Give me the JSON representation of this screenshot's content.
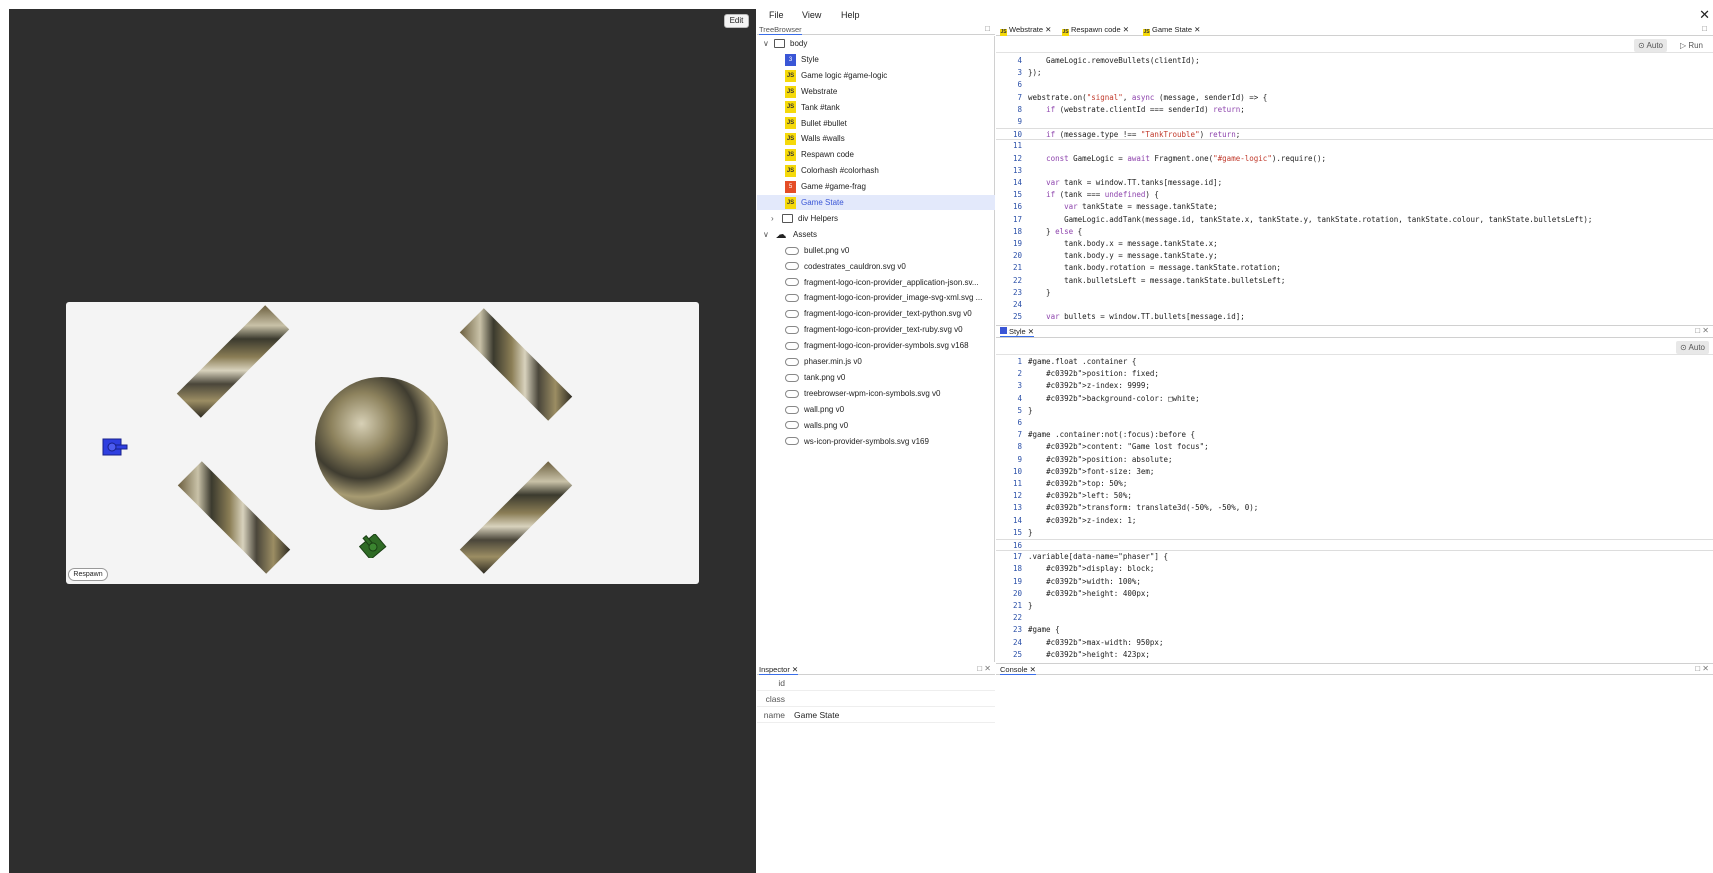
{
  "game": {
    "edit_label": "Edit",
    "respawn_label": "Respawn",
    "tank_colors": {
      "blue": "#2f3fe0",
      "green": "#2f6b25"
    }
  },
  "menubar": {
    "file": "File",
    "view": "View",
    "help": "Help",
    "close": "✕"
  },
  "tree": {
    "header": "TreeBrowser",
    "items": [
      {
        "label": "body",
        "kind": "folder"
      },
      {
        "label": "Style",
        "kind": "css"
      },
      {
        "label": "Game logic #game-logic",
        "kind": "js"
      },
      {
        "label": "Webstrate",
        "kind": "js"
      },
      {
        "label": "Tank #tank",
        "kind": "js"
      },
      {
        "label": "Bullet #bullet",
        "kind": "js"
      },
      {
        "label": "Walls #walls",
        "kind": "js"
      },
      {
        "label": "Respawn code",
        "kind": "js"
      },
      {
        "label": "Colorhash #colorhash",
        "kind": "js"
      },
      {
        "label": "Game #game-frag",
        "kind": "html"
      },
      {
        "label": "Game State",
        "kind": "js"
      },
      {
        "label": "div Helpers",
        "kind": "folder"
      },
      {
        "label": "Assets",
        "kind": "cloud"
      },
      {
        "label": "bullet.png v0",
        "kind": "asset"
      },
      {
        "label": "codestrates_cauldron.svg v0",
        "kind": "asset"
      },
      {
        "label": "fragment-logo-icon-provider_application-json.sv...",
        "kind": "asset"
      },
      {
        "label": "fragment-logo-icon-provider_image-svg-xml.svg ...",
        "kind": "asset"
      },
      {
        "label": "fragment-logo-icon-provider_text-python.svg v0",
        "kind": "asset"
      },
      {
        "label": "fragment-logo-icon-provider_text-ruby.svg v0",
        "kind": "asset"
      },
      {
        "label": "fragment-logo-icon-provider-symbols.svg v168",
        "kind": "asset"
      },
      {
        "label": "phaser.min.js v0",
        "kind": "asset"
      },
      {
        "label": "tank.png v0",
        "kind": "asset"
      },
      {
        "label": "treebrowser-wpm-icon-symbols.svg v0",
        "kind": "asset"
      },
      {
        "label": "wall.png v0",
        "kind": "asset"
      },
      {
        "label": "walls.png v0",
        "kind": "asset"
      },
      {
        "label": "ws-icon-provider-symbols.svg v169",
        "kind": "asset"
      }
    ]
  },
  "inspector": {
    "header": "Inspector ✕",
    "rows": [
      {
        "key": "id",
        "value": ""
      },
      {
        "key": "class",
        "value": ""
      },
      {
        "key": "name",
        "value": "Game State"
      }
    ]
  },
  "editor": {
    "tabs": [
      "Webstrate ✕",
      "Respawn code ✕",
      "Game State ✕"
    ],
    "auto_label": "Auto",
    "run_label": "Run",
    "lines": [
      {
        "n": "4",
        "text": "    GameLogic.removeBullets(clientId);"
      },
      {
        "n": "3",
        "text": "});"
      },
      {
        "n": "6",
        "text": ""
      },
      {
        "n": "7",
        "text": "webstrate.on(\"signal\", async (message, senderId) => {"
      },
      {
        "n": "8",
        "text": "    if (webstrate.clientId === senderId) return;"
      },
      {
        "n": "9",
        "text": ""
      },
      {
        "n": "10",
        "text": "    if (message.type !== \"TankTrouble\") return;"
      },
      {
        "n": "11",
        "text": ""
      },
      {
        "n": "12",
        "text": "    const GameLogic = await Fragment.one(\"#game-logic\").require();"
      },
      {
        "n": "13",
        "text": ""
      },
      {
        "n": "14",
        "text": "    var tank = window.TT.tanks[message.id];"
      },
      {
        "n": "15",
        "text": "    if (tank === undefined) {"
      },
      {
        "n": "16",
        "text": "        var tankState = message.tankState;"
      },
      {
        "n": "17",
        "text": "        GameLogic.addTank(message.id, tankState.x, tankState.y, tankState.rotation, tankState.colour, tankState.bulletsLeft);"
      },
      {
        "n": "18",
        "text": "    } else {"
      },
      {
        "n": "19",
        "text": "        tank.body.x = message.tankState.x;"
      },
      {
        "n": "20",
        "text": "        tank.body.y = message.tankState.y;"
      },
      {
        "n": "21",
        "text": "        tank.body.rotation = message.tankState.rotation;"
      },
      {
        "n": "22",
        "text": "        tank.bulletsLeft = message.tankState.bulletsLeft;"
      },
      {
        "n": "23",
        "text": "    }"
      },
      {
        "n": "24",
        "text": ""
      },
      {
        "n": "25",
        "text": "    var bullets = window.TT.bullets[message.id];"
      }
    ]
  },
  "style_editor": {
    "tab": "Style ✕",
    "auto_label": "Auto",
    "lines": [
      {
        "n": "1",
        "text": "#game.float .container {"
      },
      {
        "n": "2",
        "text": "    position: fixed;"
      },
      {
        "n": "3",
        "text": "    z-index: 9999;"
      },
      {
        "n": "4",
        "text": "    background-color: □white;"
      },
      {
        "n": "5",
        "text": "}"
      },
      {
        "n": "6",
        "text": ""
      },
      {
        "n": "7",
        "text": "#game .container:not(:focus):before {"
      },
      {
        "n": "8",
        "text": "    content: \"Game lost focus\";"
      },
      {
        "n": "9",
        "text": "    position: absolute;"
      },
      {
        "n": "10",
        "text": "    font-size: 3em;"
      },
      {
        "n": "11",
        "text": "    top: 50%;"
      },
      {
        "n": "12",
        "text": "    left: 50%;"
      },
      {
        "n": "13",
        "text": "    transform: translate3d(-50%, -50%, 0);"
      },
      {
        "n": "14",
        "text": "    z-index: 1;"
      },
      {
        "n": "15",
        "text": "}"
      },
      {
        "n": "16",
        "text": ""
      },
      {
        "n": "17",
        "text": ".variable[data-name=\"phaser\"] {"
      },
      {
        "n": "18",
        "text": "    display: block;"
      },
      {
        "n": "19",
        "text": "    width: 100%;"
      },
      {
        "n": "20",
        "text": "    height: 400px;"
      },
      {
        "n": "21",
        "text": "}"
      },
      {
        "n": "22",
        "text": ""
      },
      {
        "n": "23",
        "text": "#game {"
      },
      {
        "n": "24",
        "text": "    max-width: 950px;"
      },
      {
        "n": "25",
        "text": "    height: 423px;"
      }
    ]
  },
  "console": {
    "tab": "Console ✕"
  }
}
